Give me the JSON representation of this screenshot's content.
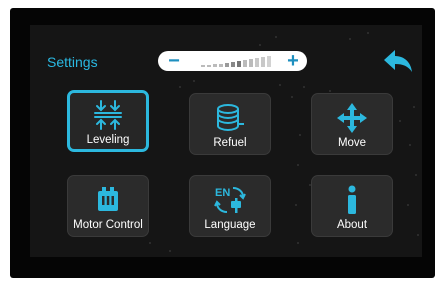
{
  "header": {
    "title": "Settings",
    "volume": {
      "minus": "−",
      "plus": "+",
      "level": 0.5
    },
    "back_icon": "back-arrow-icon"
  },
  "tiles": [
    {
      "label": "Leveling",
      "icon": "leveling-icon",
      "selected": true
    },
    {
      "label": "Refuel",
      "icon": "filament-spool-icon",
      "selected": false
    },
    {
      "label": "Move",
      "icon": "move-arrows-icon",
      "selected": false
    },
    {
      "label": "Motor Control",
      "icon": "motor-icon",
      "selected": false
    },
    {
      "label": "Language",
      "icon": "language-icon",
      "selected": false
    },
    {
      "label": "About",
      "icon": "info-icon",
      "selected": false
    }
  ],
  "colors": {
    "accent": "#2cb8de",
    "tile_bg": "#2b2b2b",
    "screen_bg": "#151515",
    "bezel": "#050505"
  }
}
